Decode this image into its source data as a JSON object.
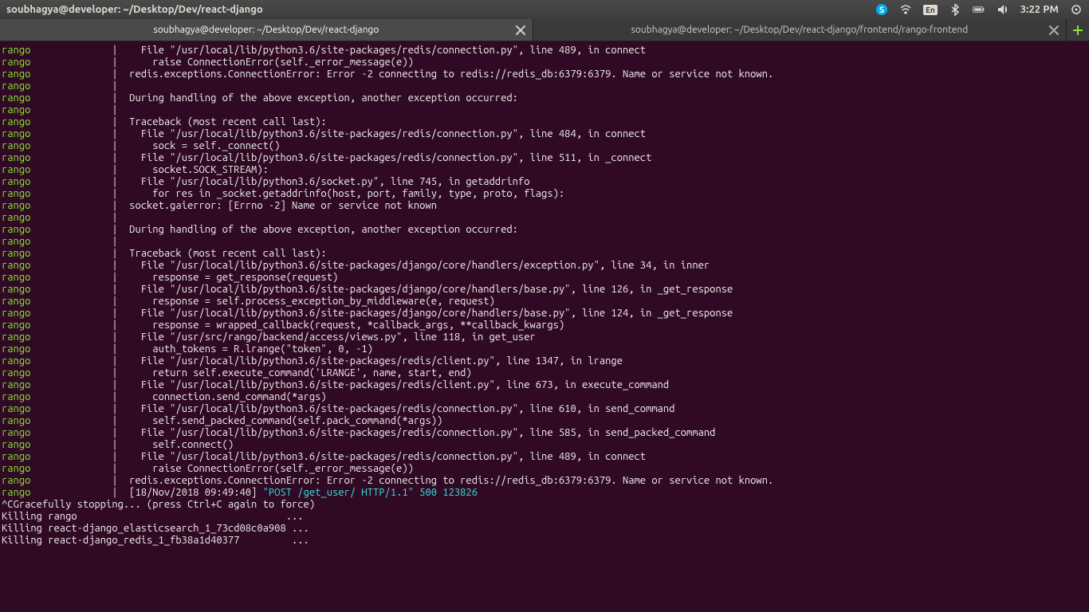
{
  "menubar": {
    "title": "soubhagya@developer: ~/Desktop/Dev/react-django",
    "lang": "En",
    "clock": "3:22 PM"
  },
  "tabs": {
    "active_label": "soubhagya@developer: ~/Desktop/Dev/react-django",
    "inactive_label": "soubhagya@developer: ~/Desktop/Dev/react-django/frontend/rango-frontend"
  },
  "terminal": {
    "tag": "rango",
    "pipe": "|",
    "lines": [
      "    File \"/usr/local/lib/python3.6/site-packages/redis/connection.py\", line 489, in connect",
      "      raise ConnectionError(self._error_message(e))",
      "  redis.exceptions.ConnectionError: Error -2 connecting to redis://redis_db:6379:6379. Name or service not known.",
      "  ",
      "  During handling of the above exception, another exception occurred:",
      "  ",
      "  Traceback (most recent call last):",
      "    File \"/usr/local/lib/python3.6/site-packages/redis/connection.py\", line 484, in connect",
      "      sock = self._connect()",
      "    File \"/usr/local/lib/python3.6/site-packages/redis/connection.py\", line 511, in _connect",
      "      socket.SOCK_STREAM):",
      "    File \"/usr/local/lib/python3.6/socket.py\", line 745, in getaddrinfo",
      "      for res in _socket.getaddrinfo(host, port, family, type, proto, flags):",
      "  socket.gaierror: [Errno -2] Name or service not known",
      "  ",
      "  During handling of the above exception, another exception occurred:",
      "  ",
      "  Traceback (most recent call last):",
      "    File \"/usr/local/lib/python3.6/site-packages/django/core/handlers/exception.py\", line 34, in inner",
      "      response = get_response(request)",
      "    File \"/usr/local/lib/python3.6/site-packages/django/core/handlers/base.py\", line 126, in _get_response",
      "      response = self.process_exception_by_middleware(e, request)",
      "    File \"/usr/local/lib/python3.6/site-packages/django/core/handlers/base.py\", line 124, in _get_response",
      "      response = wrapped_callback(request, *callback_args, **callback_kwargs)",
      "    File \"/usr/src/rango/backend/access/views.py\", line 118, in get_user",
      "      auth_tokens = R.lrange(\"token\", 0, -1)",
      "    File \"/usr/local/lib/python3.6/site-packages/redis/client.py\", line 1347, in lrange",
      "      return self.execute_command('LRANGE', name, start, end)",
      "    File \"/usr/local/lib/python3.6/site-packages/redis/client.py\", line 673, in execute_command",
      "      connection.send_command(*args)",
      "    File \"/usr/local/lib/python3.6/site-packages/redis/connection.py\", line 610, in send_command",
      "      self.send_packed_command(self.pack_command(*args))",
      "    File \"/usr/local/lib/python3.6/site-packages/redis/connection.py\", line 585, in send_packed_command",
      "      self.connect()",
      "    File \"/usr/local/lib/python3.6/site-packages/redis/connection.py\", line 489, in connect",
      "      raise ConnectionError(self._error_message(e))",
      "  redis.exceptions.ConnectionError: Error -2 connecting to redis://redis_db:6379:6379. Name or service not known."
    ],
    "log_prefix": "  [18/Nov/2018 09:49:40] ",
    "log_msg": "\"POST /get_user/ HTTP/1.1\" 500 123826",
    "bare_lines": [
      "^CGracefully stopping... (press Ctrl+C again to force)",
      "Killing rango                                    ... ",
      "Killing react-django_elasticsearch_1_73cd08c0a908 ... ",
      "Killing react-django_redis_1_fb38a1d40377         ... "
    ]
  }
}
